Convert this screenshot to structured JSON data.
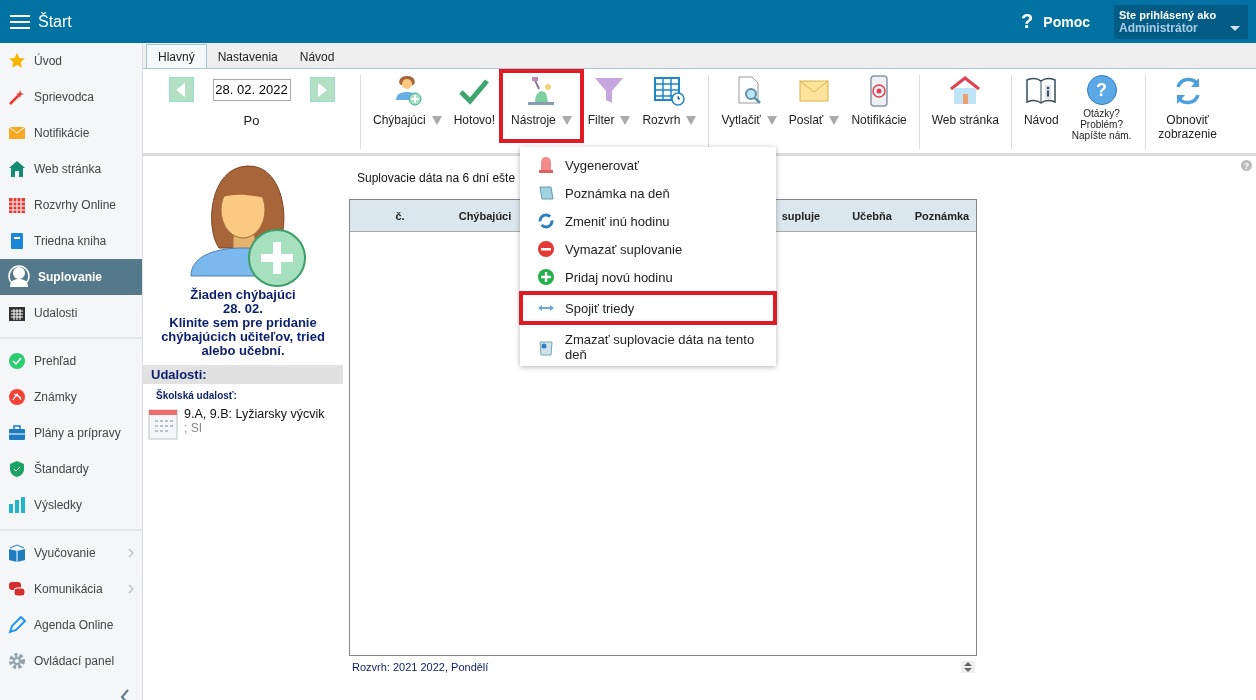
{
  "header": {
    "menu_label": "Štart",
    "help_icon": "?",
    "help": "Pomoc",
    "user_caption": "Ste prihlásený ako",
    "user_name": "Administrátor"
  },
  "sidebar": {
    "sections": [
      [
        {
          "label": "Úvod",
          "selected": false,
          "submenu": false
        },
        {
          "label": "Sprievodca",
          "selected": false,
          "submenu": false
        },
        {
          "label": "Notifikácie",
          "selected": false,
          "submenu": false
        },
        {
          "label": "Web stránka",
          "selected": false,
          "submenu": false
        },
        {
          "label": "Rozvrhy Online",
          "selected": false,
          "submenu": false
        },
        {
          "label": "Triedna kniha",
          "selected": false,
          "submenu": false
        },
        {
          "label": "Suplovanie",
          "selected": true,
          "submenu": false
        },
        {
          "label": "Udalosti",
          "selected": false,
          "submenu": false
        }
      ],
      [
        {
          "label": "Prehľad",
          "selected": false,
          "submenu": false
        },
        {
          "label": "Známky",
          "selected": false,
          "submenu": false
        },
        {
          "label": "Plány a prípravy",
          "selected": false,
          "submenu": false
        },
        {
          "label": "Štandardy",
          "selected": false,
          "submenu": false
        },
        {
          "label": "Výsledky",
          "selected": false,
          "submenu": false
        }
      ],
      [
        {
          "label": "Vyučovanie",
          "selected": false,
          "submenu": true
        },
        {
          "label": "Komunikácia",
          "selected": false,
          "submenu": true
        },
        {
          "label": "Agenda Online",
          "selected": false,
          "submenu": false
        },
        {
          "label": "Ovládací panel",
          "selected": false,
          "submenu": false
        }
      ]
    ]
  },
  "tabs": [
    {
      "label": "Hlavný",
      "selected": true
    },
    {
      "label": "Nastavenia",
      "selected": false
    },
    {
      "label": "Návod",
      "selected": false
    }
  ],
  "date_nav": {
    "date": "28. 02. 2022",
    "day": "Po"
  },
  "tool_groups": [
    [
      {
        "label": "Chýbajúci",
        "dropdown": true,
        "highlighted": false
      },
      {
        "label": "Hotovo!",
        "dropdown": false,
        "highlighted": false
      },
      {
        "label": "Nástroje",
        "dropdown": true,
        "highlighted": true
      },
      {
        "label": "Filter",
        "dropdown": true,
        "highlighted": false
      },
      {
        "label": "Rozvrh",
        "dropdown": true,
        "highlighted": false
      }
    ],
    [
      {
        "label": "Vytlačiť",
        "dropdown": true,
        "highlighted": false
      },
      {
        "label": "Poslať",
        "dropdown": true,
        "highlighted": false
      },
      {
        "label": "Notifikácie",
        "dropdown": false,
        "highlighted": false
      }
    ],
    [
      {
        "label": "Web stránka",
        "dropdown": false,
        "highlighted": false
      }
    ],
    [
      {
        "label": "Návod",
        "dropdown": false,
        "highlighted": false,
        "kind": "normal"
      },
      {
        "label": "Otázky? Problém? Napíšte nám.",
        "icon_text": "?",
        "dropdown": false,
        "highlighted": false,
        "kind": "small"
      }
    ],
    [
      {
        "label": "Obnoviť zobrazenie",
        "dropdown": false,
        "highlighted": false,
        "kind": "stacked"
      }
    ]
  ],
  "menu": [
    {
      "label": "Vygenerovať",
      "highlighted": false
    },
    {
      "label": "Poznámka na deň",
      "highlighted": false
    },
    {
      "label": "Zmeniť inú hodinu",
      "highlighted": false
    },
    {
      "label": "Vymazať suplovanie",
      "highlighted": false
    },
    {
      "label": "Pridaj novú hodinu",
      "highlighted": false
    },
    {
      "label": "Spojiť triedy",
      "highlighted": true
    },
    {
      "label": "Zmazať suplovacie dáta na tento deň",
      "highlighted": false
    }
  ],
  "absent": {
    "title": "Žiaden chýbajúci",
    "date": "28. 02.",
    "hint": "Klinite sem pre pridanie chýbajúcich učiteľov, tried alebo učební."
  },
  "events": {
    "heading": "Udalosti:",
    "category": "Školská udalosť:",
    "items": [
      {
        "title": "9.A, 9.B: Lyžiarsky výcvik",
        "note": "; SI"
      }
    ]
  },
  "table": {
    "help_icon": "?",
    "info": "Suplovacie dáta na 6 dní ešte",
    "columns": [
      "č.",
      "Chýbajúci",
      "",
      "supluje",
      "Učebňa",
      "Poznámka"
    ],
    "footer": "Rozvrh: 2021  2022, Pondělí"
  }
}
